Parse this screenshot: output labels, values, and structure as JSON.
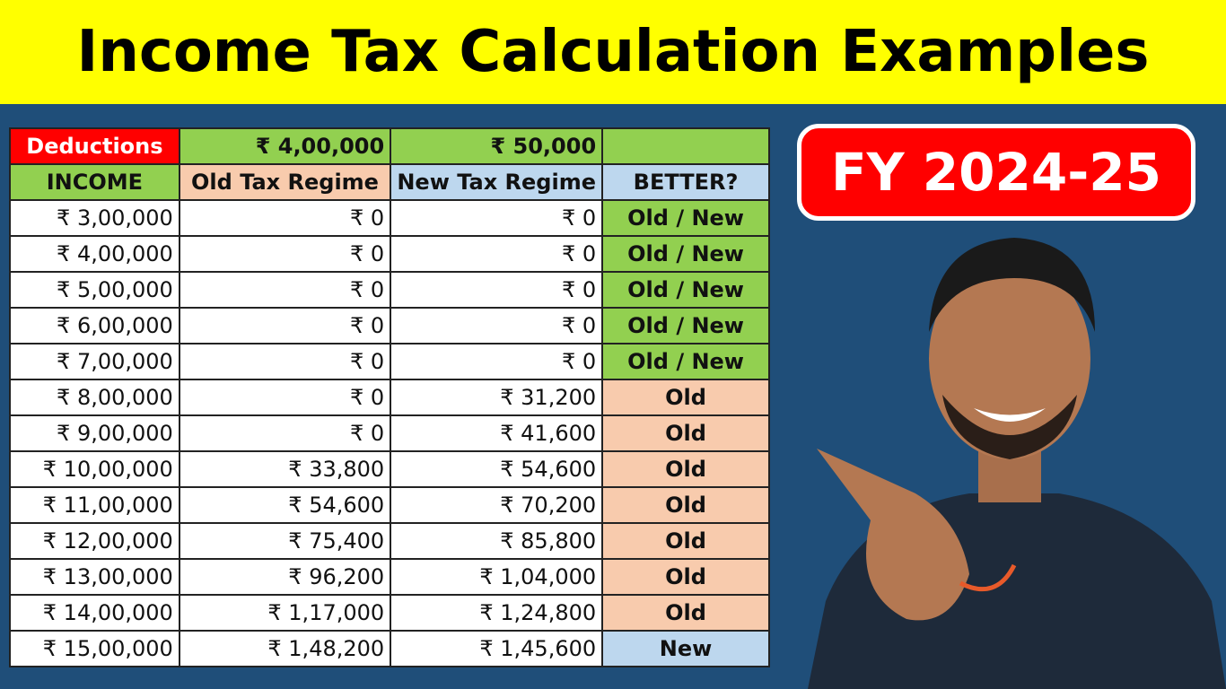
{
  "banner": {
    "title": "Income Tax Calculation Examples"
  },
  "badge": {
    "label": "FY 2024-25"
  },
  "table": {
    "deductions_row": {
      "label": "Deductions",
      "old_value": "₹ 4,00,000",
      "new_value": "₹ 50,000",
      "better": ""
    },
    "headers": [
      "INCOME",
      "Old Tax Regime",
      "New Tax Regime",
      "BETTER?"
    ],
    "rows": [
      {
        "income": "₹ 3,00,000",
        "old": "₹ 0",
        "new": "₹ 0",
        "better": "Old / New",
        "status": "both"
      },
      {
        "income": "₹ 4,00,000",
        "old": "₹ 0",
        "new": "₹ 0",
        "better": "Old / New",
        "status": "both"
      },
      {
        "income": "₹ 5,00,000",
        "old": "₹ 0",
        "new": "₹ 0",
        "better": "Old / New",
        "status": "both"
      },
      {
        "income": "₹ 6,00,000",
        "old": "₹ 0",
        "new": "₹ 0",
        "better": "Old / New",
        "status": "both"
      },
      {
        "income": "₹ 7,00,000",
        "old": "₹ 0",
        "new": "₹ 0",
        "better": "Old / New",
        "status": "both"
      },
      {
        "income": "₹ 8,00,000",
        "old": "₹ 0",
        "new": "₹ 31,200",
        "better": "Old",
        "status": "old"
      },
      {
        "income": "₹ 9,00,000",
        "old": "₹ 0",
        "new": "₹ 41,600",
        "better": "Old",
        "status": "old"
      },
      {
        "income": "₹ 10,00,000",
        "old": "₹ 33,800",
        "new": "₹ 54,600",
        "better": "Old",
        "status": "old"
      },
      {
        "income": "₹ 11,00,000",
        "old": "₹ 54,600",
        "new": "₹ 70,200",
        "better": "Old",
        "status": "old"
      },
      {
        "income": "₹ 12,00,000",
        "old": "₹ 75,400",
        "new": "₹ 85,800",
        "better": "Old",
        "status": "old"
      },
      {
        "income": "₹ 13,00,000",
        "old": "₹ 96,200",
        "new": "₹ 1,04,000",
        "better": "Old",
        "status": "old"
      },
      {
        "income": "₹ 14,00,000",
        "old": "₹ 1,17,000",
        "new": "₹ 1,24,800",
        "better": "Old",
        "status": "old"
      },
      {
        "income": "₹ 15,00,000",
        "old": "₹ 1,48,200",
        "new": "₹ 1,45,600",
        "better": "New",
        "status": "new"
      }
    ]
  },
  "colors": {
    "banner": "#ffff00",
    "background": "#1f4e79",
    "deductions": "#ff0000",
    "green": "#92d050",
    "old": "#f8cbad",
    "new": "#bdd7ee"
  }
}
